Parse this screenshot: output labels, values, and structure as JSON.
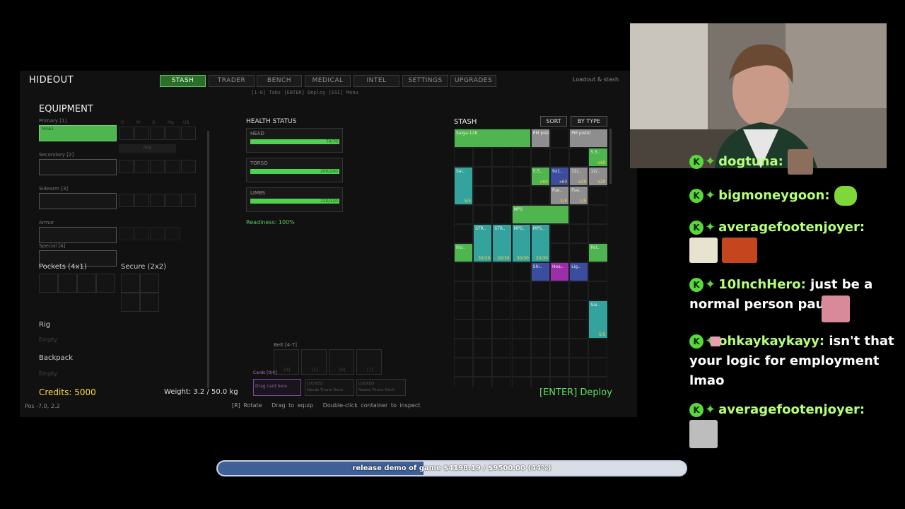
{
  "hideout": {
    "title": "HIDEOUT",
    "tabs": [
      "STASH",
      "TRADER",
      "BENCH",
      "MEDICAL",
      "INTEL",
      "SETTINGS",
      "UPGRADES"
    ],
    "active_tab": "STASH",
    "hint_tabs": "[1-8] Tabs  [ENTER] Deploy  [ESC] Menu",
    "right_label": "Loadout & stash"
  },
  "equipment": {
    "title": "EQUIPMENT",
    "primary_label": "Primary [1]",
    "primary_item": "M4A1",
    "mod_labels": [
      "O",
      "M",
      "G",
      "Mg",
      "UB"
    ],
    "mod_empty": "PR8",
    "secondary_label": "Secondary [2]",
    "sidearm_label": "Sidearm [3]",
    "armor_label": "Armor",
    "special_label": "Special [4]",
    "pockets_label": "Pockets (4x1)",
    "secure_label": "Secure (2x2)",
    "rig_label": "Rig",
    "rig_value": "Empty",
    "backpack_label": "Backpack",
    "backpack_value": "Empty",
    "credits": "Credits: 5000",
    "weight": "Weight: 3.2 / 50.0 kg",
    "pos": "Pos -7.0, 2.2"
  },
  "health": {
    "title": "HEALTH STATUS",
    "parts": [
      {
        "label": "HEAD",
        "value": "70/70",
        "fraction": 1.0
      },
      {
        "label": "TORSO",
        "value": "200/200",
        "fraction": 1.0
      },
      {
        "label": "LIMBS",
        "value": "120/120",
        "fraction": 1.0
      }
    ],
    "readiness": "Readiness: 100%"
  },
  "belt": {
    "label": "Belt [4-7]",
    "slots": [
      "[4]",
      "[5]",
      "[6]",
      "[7]"
    ],
    "cards_label": "Cards [0/4]",
    "card_drop": "Drag card here",
    "locked_1": "LOCKED",
    "locked_1_sub": "Needs Triune Deck",
    "locked_2": "LOCKED",
    "locked_2_sub": "Needs Triune Deck"
  },
  "controls_hint": "[R] Rotate   Drag to equip   Double-click container to inspect",
  "stash": {
    "title": "STASH",
    "sort_label": "SORT",
    "by_type_label": "BY TYPE",
    "items": [
      {
        "name": "Saiga-12K",
        "color": "g"
      },
      {
        "name": "PM pistol",
        "color": "gray"
      },
      {
        "name": "PM pistol",
        "color": "gray"
      },
      {
        "name": "5.5..",
        "count": "x60",
        "color": "g"
      },
      {
        "name": "Sai..",
        "count": "5/5",
        "color": "teal"
      },
      {
        "name": "5.5..",
        "count": "x60",
        "color": "g"
      },
      {
        "name": "9x1..",
        "count": "x60",
        "color": "blue"
      },
      {
        "name": "12/..",
        "count": "x20",
        "color": "gray"
      },
      {
        "name": "12/..",
        "count": "x20",
        "color": "gray"
      },
      {
        "name": "Fue..",
        "count": "1/5",
        "color": "gray"
      },
      {
        "name": "Fue..",
        "count": "1/5",
        "color": "gray"
      },
      {
        "name": "MPS",
        "color": "g"
      },
      {
        "name": "STR..",
        "count": "30/30",
        "color": "teal"
      },
      {
        "name": "STR..",
        "count": "30/30",
        "color": "teal"
      },
      {
        "name": "MPS..",
        "count": "30/30",
        "color": "teal"
      },
      {
        "name": "MPS..",
        "count": "30/30",
        "color": "teal"
      },
      {
        "name": "Fro..",
        "color": "g"
      },
      {
        "name": "Pol..",
        "color": "g"
      },
      {
        "name": "Shi..",
        "color": "blue"
      },
      {
        "name": "Hea..",
        "color": "purple"
      },
      {
        "name": "Lig..",
        "color": "blue"
      },
      {
        "name": "Sai..",
        "count": "5/5",
        "color": "teal"
      }
    ]
  },
  "deploy_label": "[ENTER] Deploy",
  "chat": [
    {
      "user": "dogtuna:",
      "text": ""
    },
    {
      "user": "bigmoneygoon:",
      "text": ""
    },
    {
      "user": "averagefootenjoyer:",
      "text": ""
    },
    {
      "user": "10InchHero:",
      "text": "just be a normal person paul"
    },
    {
      "user": "ohkaykaykayy:",
      "text": "isn't that your logic for employment lmao"
    },
    {
      "user": "averagefootenjoyer:",
      "text": ""
    }
  ],
  "goal": {
    "text": "release demo of game $4198.19 / $9500.00 (44%)",
    "progress": 0.44,
    "fill_color": "#3f5f97"
  }
}
